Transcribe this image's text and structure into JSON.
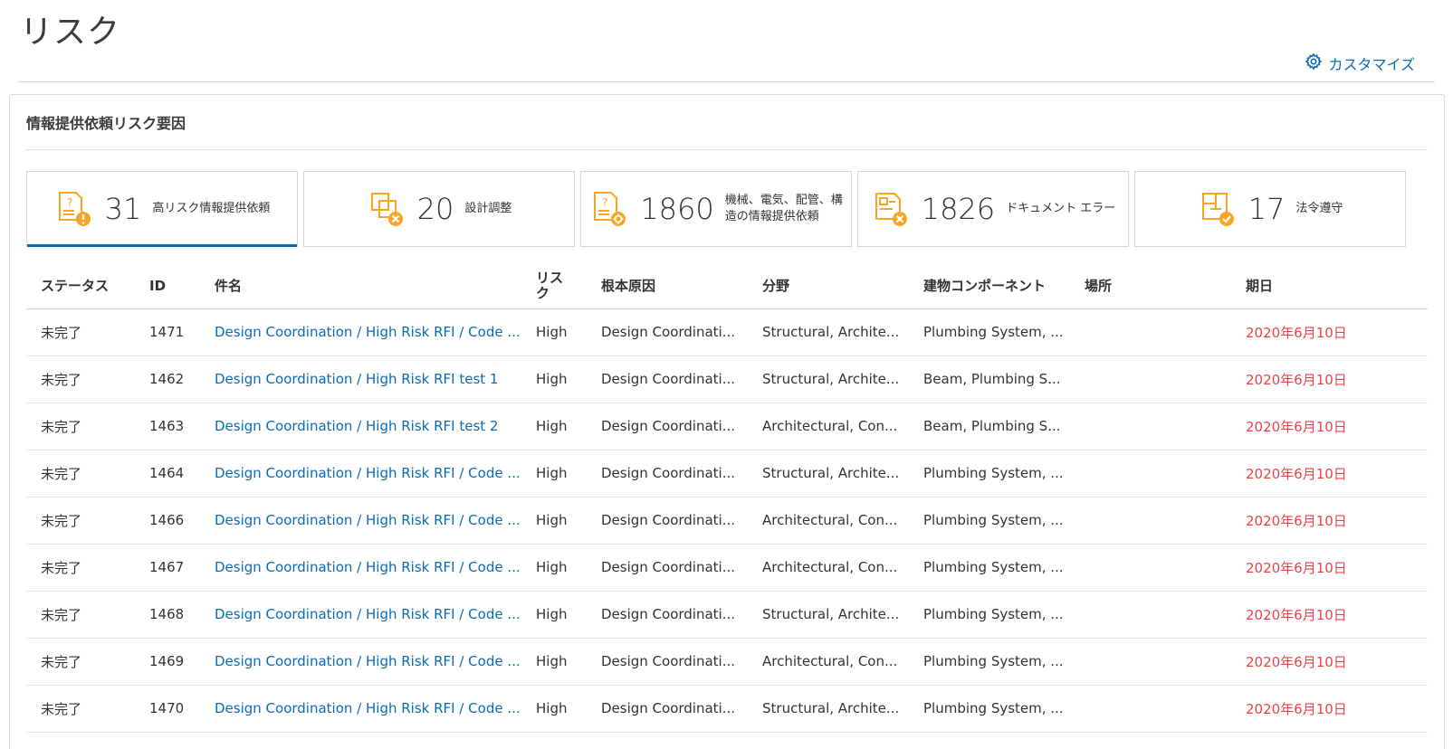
{
  "header": {
    "title": "リスク",
    "customize_label": "カスタマイズ"
  },
  "card": {
    "title": "情報提供依頼リスク要因"
  },
  "tiles": [
    {
      "count": "31",
      "label": "高リスク情報提供依頼",
      "icon": "rfi-warning-icon",
      "active": true
    },
    {
      "count": "20",
      "label": "設計調整",
      "icon": "design-coordination-icon",
      "active": false
    },
    {
      "count": "1860",
      "label": "機械、電気、配管、構造の情報提供依頼",
      "icon": "rfi-mep-icon",
      "active": false
    },
    {
      "count": "1826",
      "label": "ドキュメント エラー",
      "icon": "document-error-icon",
      "active": false
    },
    {
      "count": "17",
      "label": "法令遵守",
      "icon": "code-compliance-icon",
      "active": false
    }
  ],
  "table": {
    "columns": [
      "ステータス",
      "ID",
      "件名",
      "リスク",
      "根本原因",
      "分野",
      "建物コンポーネント",
      "場所",
      "期日"
    ],
    "rows": [
      [
        "未完了",
        "1471",
        "Design Coordination / High Risk RFI / Code ...",
        "High",
        "Design Coordinati...",
        "Structural, Archite...",
        "Plumbing System, ...",
        "",
        "2020年6月10日"
      ],
      [
        "未完了",
        "1462",
        "Design Coordination / High Risk RFI test 1",
        "High",
        "Design Coordinati...",
        "Structural, Archite...",
        "Beam, Plumbing S...",
        "",
        "2020年6月10日"
      ],
      [
        "未完了",
        "1463",
        "Design Coordination / High Risk RFI test 2",
        "High",
        "Design Coordinati...",
        "Architectural, Con...",
        "Beam, Plumbing S...",
        "",
        "2020年6月10日"
      ],
      [
        "未完了",
        "1464",
        "Design Coordination / High Risk RFI / Code ...",
        "High",
        "Design Coordinati...",
        "Structural, Archite...",
        "Plumbing System, ...",
        "",
        "2020年6月10日"
      ],
      [
        "未完了",
        "1466",
        "Design Coordination / High Risk RFI / Code ...",
        "High",
        "Design Coordinati...",
        "Architectural, Con...",
        "Plumbing System, ...",
        "",
        "2020年6月10日"
      ],
      [
        "未完了",
        "1467",
        "Design Coordination / High Risk RFI / Code ...",
        "High",
        "Design Coordinati...",
        "Architectural, Con...",
        "Plumbing System, ...",
        "",
        "2020年6月10日"
      ],
      [
        "未完了",
        "1468",
        "Design Coordination / High Risk RFI / Code ...",
        "High",
        "Design Coordinati...",
        "Structural, Archite...",
        "Plumbing System, ...",
        "",
        "2020年6月10日"
      ],
      [
        "未完了",
        "1469",
        "Design Coordination / High Risk RFI / Code ...",
        "High",
        "Design Coordinati...",
        "Architectural, Con...",
        "Plumbing System, ...",
        "",
        "2020年6月10日"
      ],
      [
        "未完了",
        "1470",
        "Design Coordination / High Risk RFI / Code ...",
        "High",
        "Design Coordinati...",
        "Structural, Archite...",
        "Plumbing System, ...",
        "",
        "2020年6月10日"
      ]
    ]
  },
  "colors": {
    "accent": "#0a6cb5",
    "icon_orange": "#f5a623",
    "due_red": "#e8434a"
  }
}
